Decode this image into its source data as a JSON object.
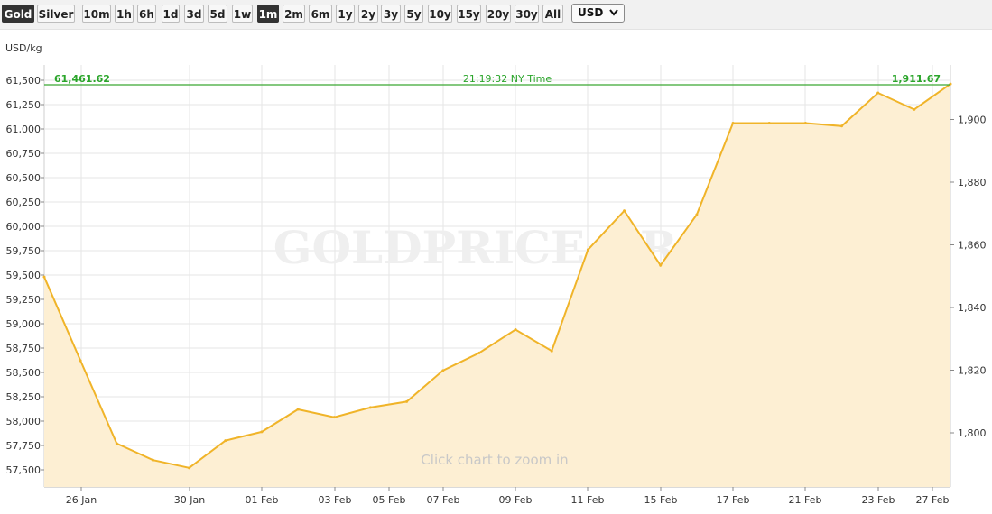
{
  "toolbar": {
    "metal_buttons": [
      {
        "label": "Gold",
        "selected": true
      },
      {
        "label": "Silver",
        "selected": false
      }
    ],
    "range_buttons": [
      {
        "label": "10m",
        "selected": false
      },
      {
        "label": "1h",
        "selected": false
      },
      {
        "label": "6h",
        "selected": false
      },
      {
        "label": "1d",
        "selected": false
      },
      {
        "label": "3d",
        "selected": false
      },
      {
        "label": "5d",
        "selected": false
      },
      {
        "label": "1w",
        "selected": false
      },
      {
        "label": "1m",
        "selected": true
      },
      {
        "label": "2m",
        "selected": false
      },
      {
        "label": "6m",
        "selected": false
      },
      {
        "label": "1y",
        "selected": false
      },
      {
        "label": "2y",
        "selected": false
      },
      {
        "label": "3y",
        "selected": false
      },
      {
        "label": "5y",
        "selected": false
      },
      {
        "label": "10y",
        "selected": false
      },
      {
        "label": "15y",
        "selected": false
      },
      {
        "label": "20y",
        "selected": false
      },
      {
        "label": "30y",
        "selected": false
      },
      {
        "label": "All",
        "selected": false
      }
    ],
    "currency": {
      "value": "USD",
      "icon": "chevron-down-icon"
    }
  },
  "chart_data": {
    "type": "area",
    "unit_label": "USD/kg",
    "watermark": "GOLDPRICE.ORG",
    "hint": "Click chart to zoom in",
    "current_value_left": "61,461.62",
    "current_value_right": "1,911.67",
    "timestamp": "21:19:32 NY Time",
    "grid": true,
    "colors": {
      "line": "#f0b429",
      "fill": "#fdefd3",
      "current_line": "#3aa833",
      "current_text": "#2aa52a",
      "grid": "#e6e6e6"
    },
    "y_left": {
      "range": [
        57500,
        61500
      ],
      "ticks": [
        "57,500",
        "57,750",
        "58,000",
        "58,250",
        "58,500",
        "58,750",
        "59,000",
        "59,250",
        "59,500",
        "59,750",
        "60,000",
        "60,250",
        "60,500",
        "60,750",
        "61,000",
        "61,250",
        "61,500"
      ]
    },
    "y_right": {
      "ticks": [
        "1,800",
        "1,820",
        "1,840",
        "1,860",
        "1,880",
        "1,900"
      ]
    },
    "x_labels": [
      "26 Jan",
      "30 Jan",
      "01 Feb",
      "03 Feb",
      "05 Feb",
      "07 Feb",
      "09 Feb",
      "11 Feb",
      "15 Feb",
      "17 Feb",
      "21 Feb",
      "23 Feb",
      "27 Feb"
    ],
    "series": [
      {
        "values": [
          59480,
          58620,
          57770,
          57600,
          57520,
          57800,
          57890,
          58120,
          58040,
          58140,
          58200,
          58520,
          58700,
          58940,
          58720,
          59760,
          60160,
          59600,
          60120,
          61060,
          61060,
          61060,
          61030,
          61370,
          61200,
          61461.62
        ]
      }
    ]
  }
}
